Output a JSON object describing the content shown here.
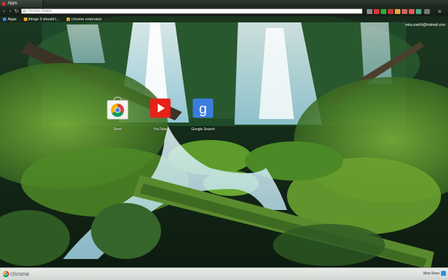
{
  "tab": {
    "title": "Apps"
  },
  "omnibox": {
    "value": "chrome://apps"
  },
  "bookmarks": [
    {
      "label": "Apps",
      "color": "#3b7ddd"
    },
    {
      "label": "things 3 should l...",
      "color": "#e3a32a"
    },
    {
      "label": "chrome extension",
      "color": "#e3a32a"
    }
  ],
  "user": {
    "email": "nela.cow04@hotmail.com"
  },
  "apps": [
    {
      "label": "Store",
      "icon": "chrome-web-store-icon"
    },
    {
      "label": "YouTube",
      "icon": "youtube-icon"
    },
    {
      "label": "Google Search",
      "icon": "google-search-icon"
    }
  ],
  "footer": {
    "brand": "chrome",
    "web_store": "Web Store"
  },
  "colors": {
    "toolbar": "#1f2a20",
    "footer": "#e2e5e2",
    "accent_blue": "#2f6fd6"
  }
}
